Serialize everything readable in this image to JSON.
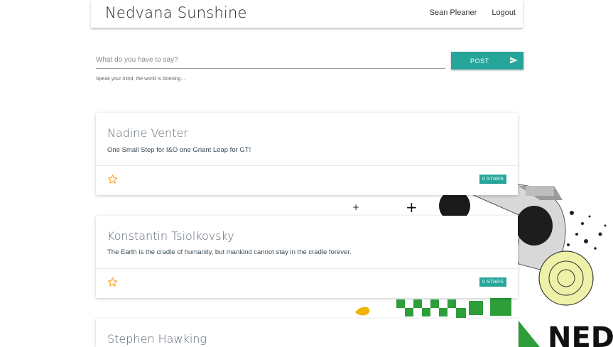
{
  "header": {
    "brand": "Nedvana Sunshine",
    "user_link": "Sean Pleaner",
    "logout_link": "Logout"
  },
  "composer": {
    "placeholder": "What do you have to say?",
    "value": "",
    "helper": "Speak your mind, the world is listening...",
    "post_label": "POST"
  },
  "posts": [
    {
      "author": "Nadine Venter",
      "message": "One Small Step for I&O one Griant Leap for GT!",
      "stars": "0 STARS"
    },
    {
      "author": "Konstantin Tsiolkovsky",
      "message": "The Earth is the cradle of humanity, but mankind cannot stay in the cradle forever.",
      "stars": "0 STARS"
    },
    {
      "author": "Stephen Hawking",
      "message": "",
      "stars": ""
    }
  ],
  "background": {
    "logo_text": "NED"
  },
  "colors": {
    "accent": "#26a69a",
    "star": "#f5a623"
  }
}
